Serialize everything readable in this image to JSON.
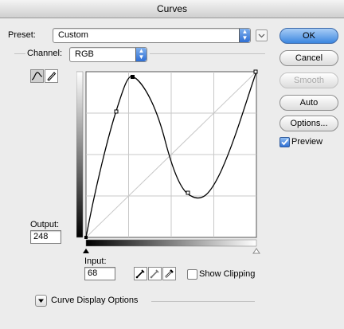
{
  "window": {
    "title": "Curves"
  },
  "preset": {
    "label": "Preset:",
    "value": "Custom"
  },
  "channel": {
    "label": "Channel:",
    "value": "RGB"
  },
  "buttons": {
    "ok": "OK",
    "cancel": "Cancel",
    "smooth": "Smooth",
    "auto": "Auto",
    "options": "Options..."
  },
  "preview": {
    "label": "Preview",
    "checked": true
  },
  "output": {
    "label": "Output:",
    "value": "248"
  },
  "input": {
    "label": "Input:",
    "value": "68"
  },
  "show_clipping": {
    "label": "Show Clipping",
    "checked": false
  },
  "curve_display": {
    "label": "Curve Display Options"
  },
  "icons": [
    "preset-menu-icon",
    "curve-point-tool-icon",
    "pencil-tool-icon",
    "black-eyedropper-icon",
    "gray-eyedropper-icon",
    "white-eyedropper-icon",
    "disclosure-triangle-icon",
    "checkmark-icon"
  ],
  "colors": {
    "accent": "#3c86e0",
    "curve": "#000000",
    "grid": "#c8c8c8"
  }
}
